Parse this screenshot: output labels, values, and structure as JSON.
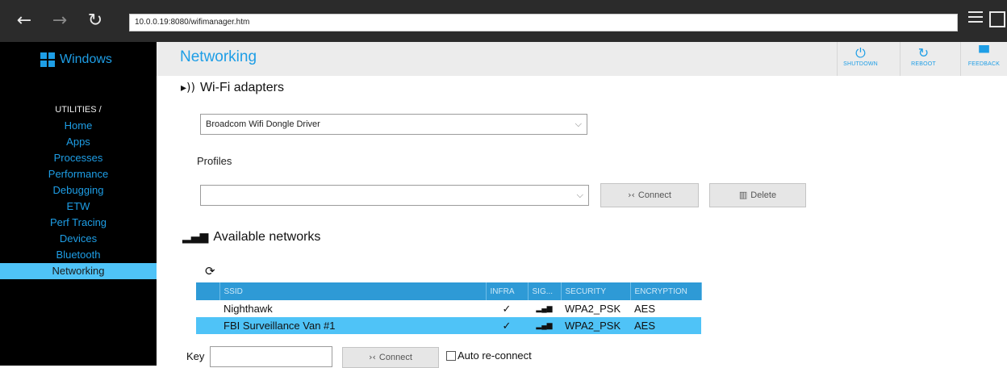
{
  "browser": {
    "back_icon": "←",
    "forward_icon": "→",
    "refresh_icon": "↻",
    "url": "10.0.0.19:8080/wifimanager.htm"
  },
  "sidebar": {
    "brand": "Windows",
    "section": "UTILITIES /",
    "items": [
      {
        "label": "Home"
      },
      {
        "label": "Apps"
      },
      {
        "label": "Processes"
      },
      {
        "label": "Performance"
      },
      {
        "label": "Debugging"
      },
      {
        "label": "ETW"
      },
      {
        "label": "Perf Tracing"
      },
      {
        "label": "Devices"
      },
      {
        "label": "Bluetooth"
      },
      {
        "label": "Networking"
      }
    ],
    "active": "Networking"
  },
  "header": {
    "title": "Networking",
    "shutdown_label": "SHUTDOWN",
    "reboot_label": "REBOOT",
    "feedback_label": "FEEDBACK"
  },
  "wifi": {
    "heading": "Wi-Fi adapters",
    "adapter_selected": "Broadcom Wifi Dongle Driver",
    "profiles_label": "Profiles",
    "profiles_selected": "",
    "connect_label": "Connect",
    "delete_label": "Delete"
  },
  "networks": {
    "heading": "Available networks",
    "columns": [
      "SSID",
      "INFRA",
      "SIG...",
      "SECURITY",
      "ENCRYPTION"
    ],
    "rows": [
      {
        "ssid": "Nighthawk",
        "infra": "✓",
        "sig": "▂▄▆",
        "security": "WPA2_PSK",
        "encryption": "AES",
        "selected": false
      },
      {
        "ssid": "FBI Surveillance Van #1",
        "infra": "✓",
        "sig": "▂▄▆",
        "security": "WPA2_PSK",
        "encryption": "AES",
        "selected": true
      }
    ],
    "key_label": "Key",
    "key_value": "",
    "connect_label": "Connect",
    "auto_reconnect_label": "Auto re-connect"
  },
  "colors": {
    "accent": "#1e9ee6",
    "selected": "#4fc3f7",
    "table_header": "#2e9ad6"
  }
}
